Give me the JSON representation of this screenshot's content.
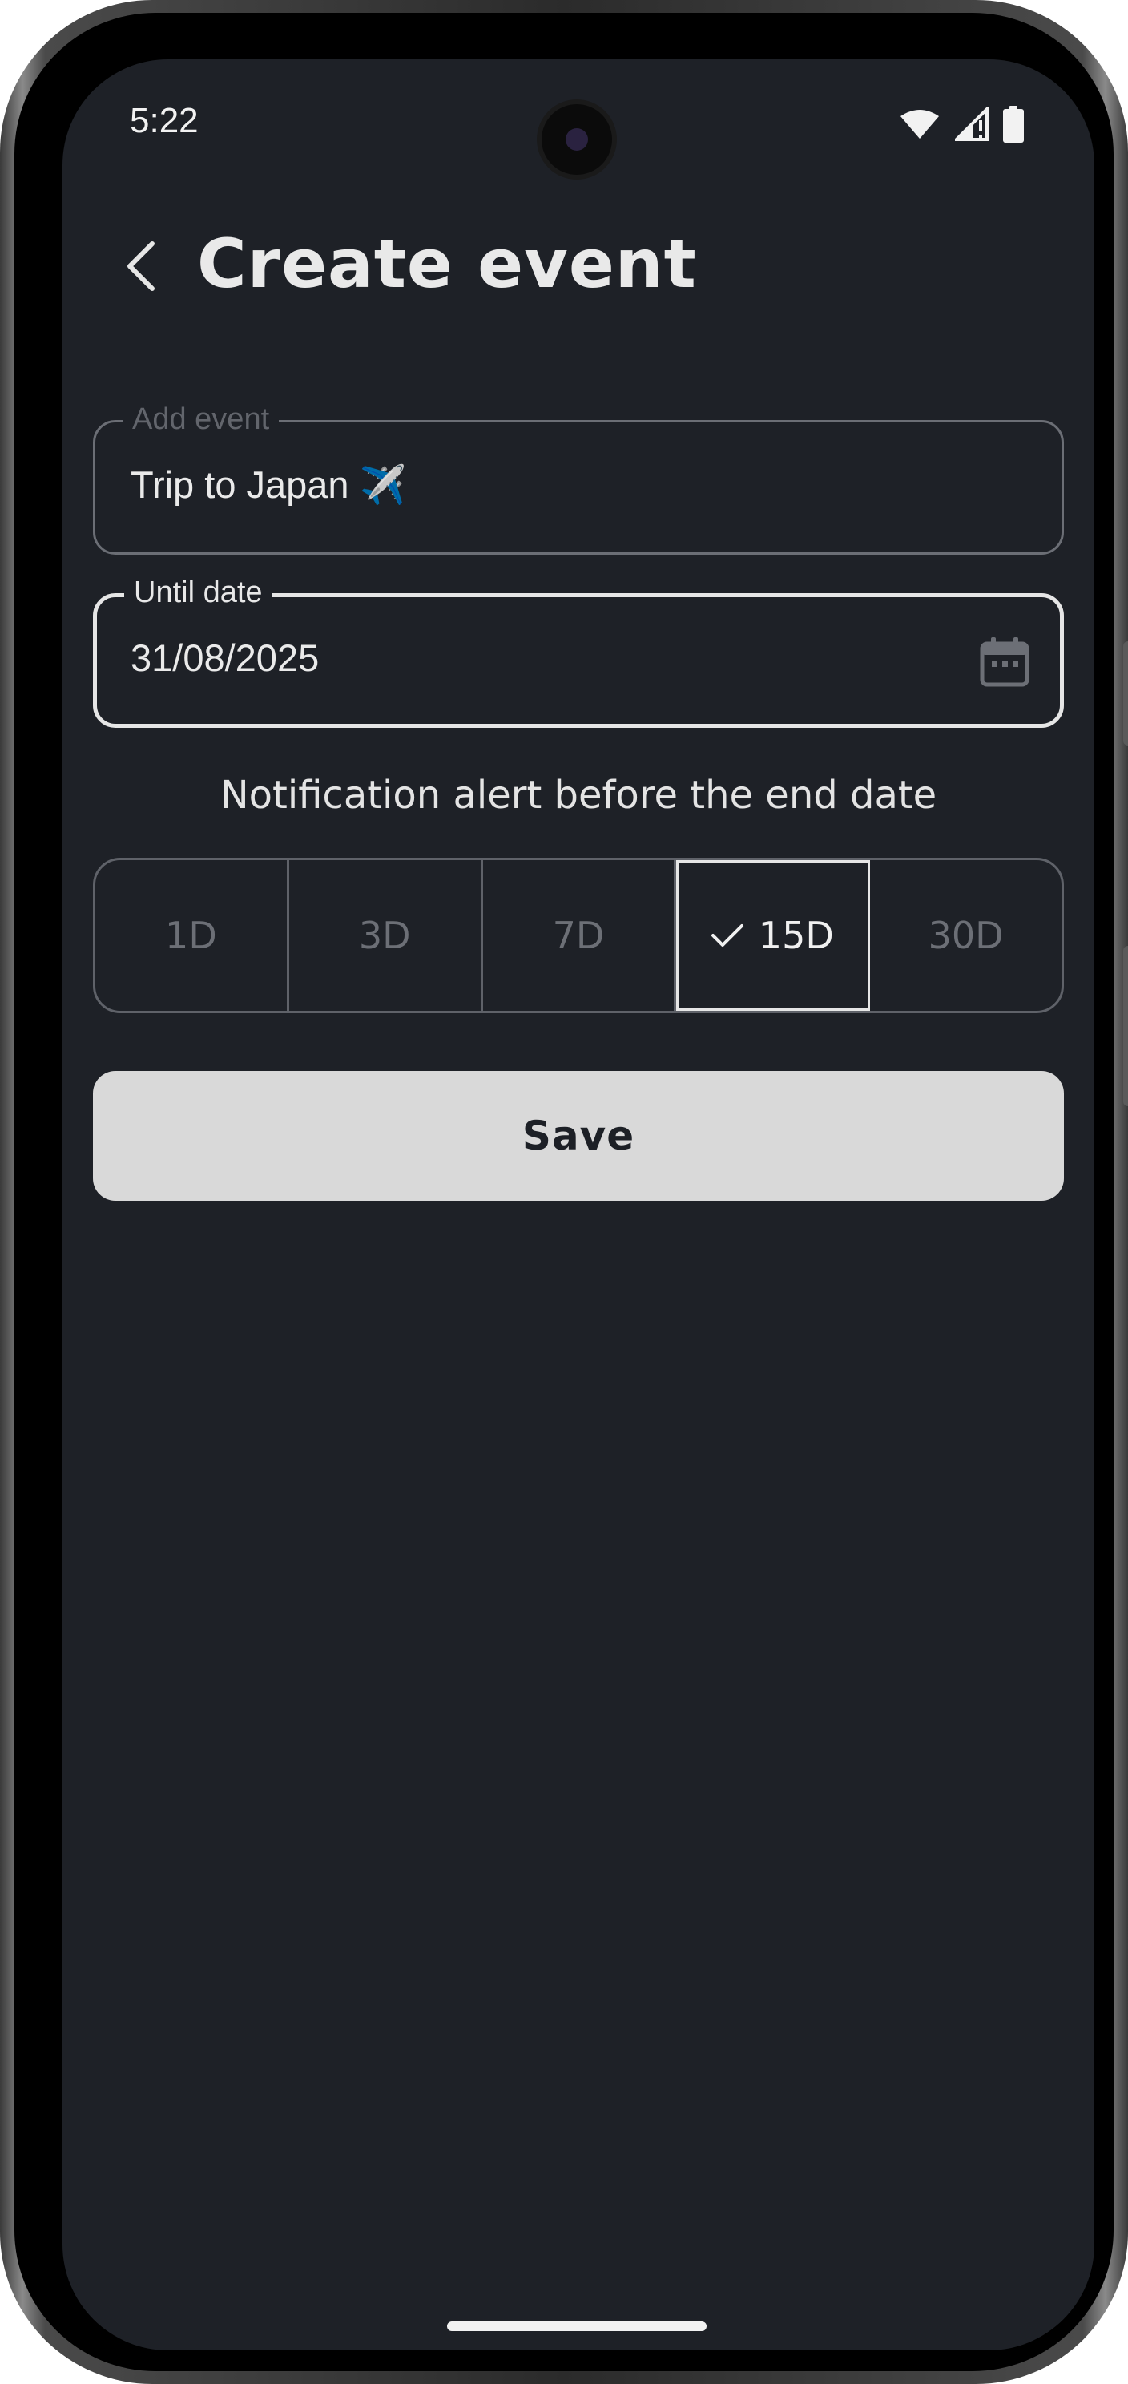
{
  "status_bar": {
    "time": "5:22",
    "icons": [
      "wifi-icon",
      "signal-icon",
      "battery-icon"
    ]
  },
  "header": {
    "back_icon": "chevron-left-icon",
    "title": "Create event"
  },
  "form": {
    "event_field": {
      "label": "Add event",
      "value": "Trip to Japan ✈️"
    },
    "date_field": {
      "label": "Until date",
      "value": "31/08/2025",
      "icon": "calendar-icon"
    }
  },
  "notification": {
    "caption": "Notification alert before the end date",
    "options": [
      {
        "label": "1D",
        "selected": false
      },
      {
        "label": "3D",
        "selected": false
      },
      {
        "label": "7D",
        "selected": false
      },
      {
        "label": "15D",
        "selected": true
      },
      {
        "label": "30D",
        "selected": false
      }
    ]
  },
  "actions": {
    "save_label": "Save"
  },
  "colors": {
    "background": "#1e2127",
    "text": "#e6e6e6",
    "muted": "#6c6f76",
    "button_bg": "#d9d9d9",
    "button_text": "#1d2026"
  }
}
